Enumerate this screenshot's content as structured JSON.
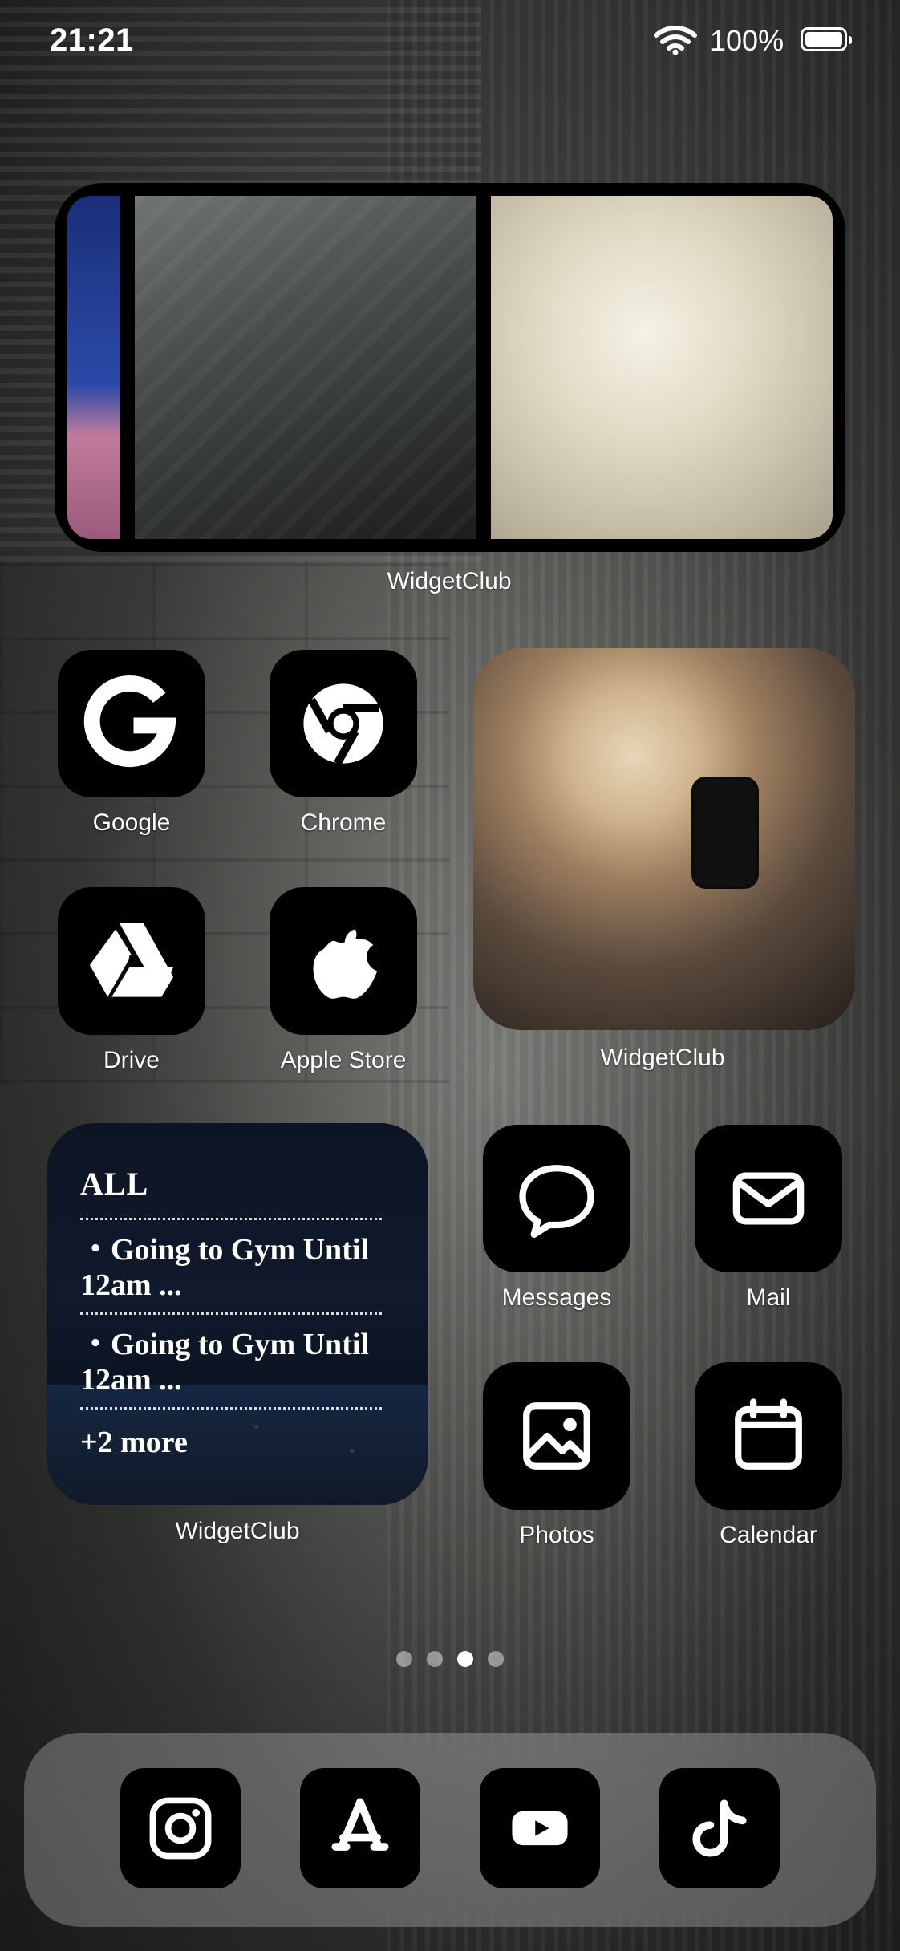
{
  "status_bar": {
    "time": "21:21",
    "battery_percent": "100%",
    "icons": [
      "wifi-icon",
      "battery-icon"
    ]
  },
  "widgets": {
    "top_photo": {
      "label": "WidgetClub"
    },
    "selfie_photo": {
      "label": "WidgetClub"
    },
    "reminders": {
      "label": "WidgetClub",
      "title": "ALL",
      "items": [
        "・Going to Gym Until 12am ...",
        "・Going to Gym Until 12am ..."
      ],
      "more": "+2 more"
    }
  },
  "apps": [
    {
      "label": "Google",
      "icon": "google-icon"
    },
    {
      "label": "Chrome",
      "icon": "chrome-icon"
    },
    {
      "label": "Drive",
      "icon": "drive-icon"
    },
    {
      "label": "Apple Store",
      "icon": "apple-icon"
    },
    {
      "label": "Messages",
      "icon": "messages-icon"
    },
    {
      "label": "Mail",
      "icon": "mail-icon"
    },
    {
      "label": "Photos",
      "icon": "photos-icon"
    },
    {
      "label": "Calendar",
      "icon": "calendar-icon"
    }
  ],
  "page_indicator": {
    "pages": 4,
    "current": 3
  },
  "dock": {
    "icons": [
      "instagram-icon",
      "app-store-icon",
      "youtube-icon",
      "tiktok-icon"
    ]
  },
  "colors": {
    "tile": "#000000",
    "label": "#FFFFFF",
    "dock_bg": "rgba(235,235,235,0.28)"
  }
}
